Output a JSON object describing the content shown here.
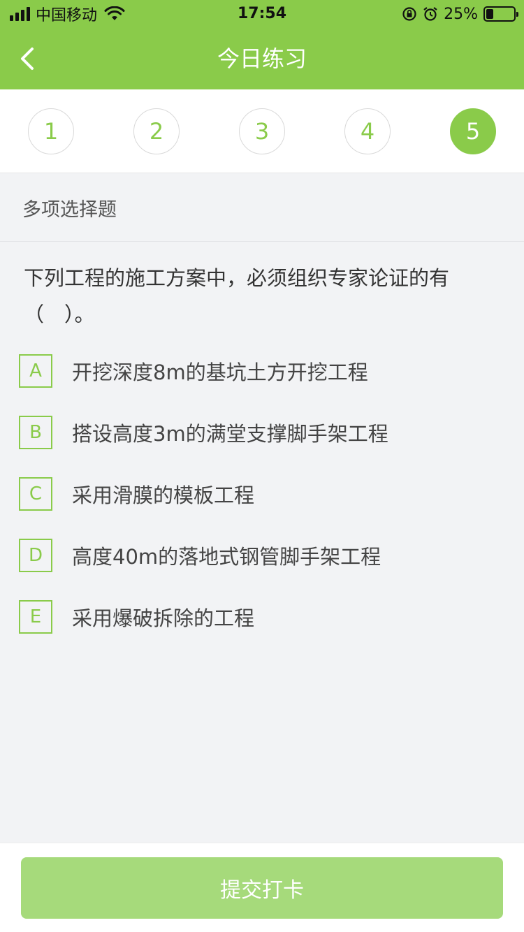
{
  "status_bar": {
    "carrier": "中国移动",
    "time": "17:54",
    "battery_percent": "25%",
    "battery_level": 0.25,
    "icons": [
      "signal-icon",
      "wifi-icon",
      "rotation-lock-icon",
      "alarm-icon",
      "battery-icon"
    ]
  },
  "nav": {
    "title": "今日练习",
    "back_icon": "chevron-left-icon"
  },
  "steps": {
    "items": [
      "1",
      "2",
      "3",
      "4",
      "5"
    ],
    "active_index": 4
  },
  "question": {
    "type": "多项选择题",
    "text": "下列工程的施工方案中，必须组织专家论证的有（　）。",
    "options": [
      {
        "letter": "A",
        "text": "开挖深度8m的基坑土方开挖工程"
      },
      {
        "letter": "B",
        "text": "搭设高度3m的满堂支撑脚手架工程"
      },
      {
        "letter": "C",
        "text": "采用滑膜的模板工程"
      },
      {
        "letter": "D",
        "text": "高度40m的落地式钢管脚手架工程"
      },
      {
        "letter": "E",
        "text": "采用爆破拆除的工程"
      }
    ]
  },
  "footer": {
    "submit_label": "提交打卡"
  },
  "colors": {
    "accent": "#8acb4a",
    "button_disabled": "#a6da7b",
    "background": "#f2f3f5"
  }
}
